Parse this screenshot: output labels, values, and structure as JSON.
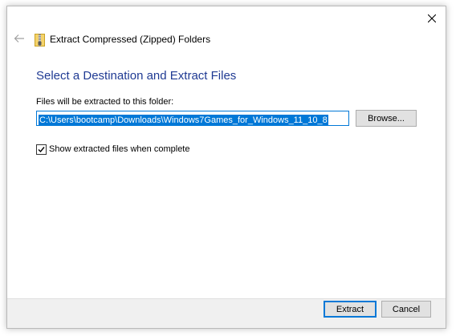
{
  "window": {
    "title": "Extract Compressed (Zipped) Folders"
  },
  "page": {
    "heading": "Select a Destination and Extract Files",
    "folder_label": "Files will be extracted to this folder:",
    "path_value": "C:\\Users\\bootcamp\\Downloads\\Windows7Games_for_Windows_11_10_8",
    "browse_label": "Browse...",
    "show_files_label": "Show extracted files when complete",
    "show_files_checked": true
  },
  "footer": {
    "extract_label": "Extract",
    "cancel_label": "Cancel"
  },
  "icons": {
    "close": "close-icon",
    "back": "back-arrow-icon",
    "zip": "zip-folder-icon",
    "check": "checkmark-icon"
  },
  "colors": {
    "heading": "#1f3a93",
    "accent": "#0078d7",
    "footer_bg": "#f0f0f0"
  }
}
